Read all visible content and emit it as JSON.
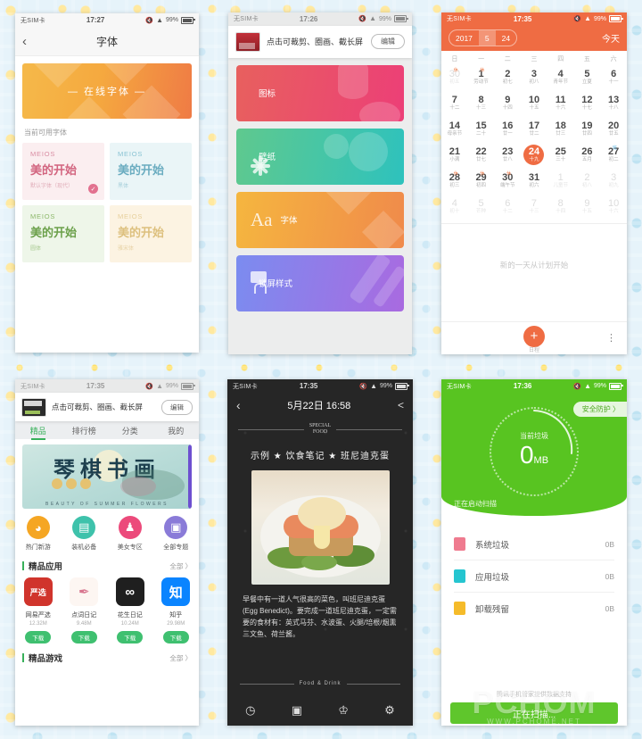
{
  "background": {
    "style": "stars-and-suns-pattern",
    "color": "#e6f3fa"
  },
  "panel_font": {
    "status": {
      "carrier": "无SIM卡",
      "time": "17:27",
      "battery": "99%"
    },
    "nav": {
      "back": "‹",
      "title": "字体"
    },
    "banner_label": "— 在线字体 —",
    "section_label": "当前可用字体",
    "fonts": [
      {
        "eng": "MEIOS",
        "cn": "美的开始",
        "sub": "默认字体（现代）",
        "selected": true,
        "bg": "#fbeef0",
        "eng_color": "#d98da3",
        "cn_color": "#d2647f",
        "sub_color": "#dba0ae"
      },
      {
        "eng": "MEIOS",
        "cn": "美的开始",
        "sub": "黑体",
        "selected": false,
        "bg": "#eaf5f7",
        "eng_color": "#89c3d3",
        "cn_color": "#6aacc0",
        "sub_color": "#9cc9d6"
      },
      {
        "eng": "MEIOS",
        "cn": "美的开始",
        "sub": "圆体",
        "selected": false,
        "bg": "#eef6e9",
        "eng_color": "#8cb86a",
        "cn_color": "#6ba04a",
        "sub_color": "#9ec383"
      },
      {
        "eng": "MEIOS",
        "cn": "美的开始",
        "sub": "雅宋体",
        "selected": false,
        "bg": "#fcf3e2",
        "eng_color": "#e6cf9b",
        "cn_color": "#ddc07e",
        "sub_color": "#e4cd9c"
      }
    ]
  },
  "panel_theme": {
    "status": {
      "carrier": "无SIM卡",
      "time": "17:26",
      "battery": "99%"
    },
    "screenshot_bar": {
      "text": "点击可裁剪、圈画、截长屏",
      "button": "编辑"
    },
    "tiles": [
      {
        "label": "图标",
        "icon": "cylinder-icon"
      },
      {
        "label": "壁纸",
        "icon": "flower-icon"
      },
      {
        "label": "字体",
        "icon": "aa-icon"
      },
      {
        "label": "锁屏样式",
        "icon": "lock-icon"
      }
    ]
  },
  "panel_calendar": {
    "status": {
      "carrier": "无SIM卡",
      "time": "17:35",
      "battery": "99%"
    },
    "header": {
      "year": "2017",
      "month": "5",
      "day": "24",
      "today": "今天"
    },
    "weekdays": [
      "日",
      "一",
      "二",
      "三",
      "四",
      "五",
      "六"
    ],
    "empty_hint": "新的一天从计划开始",
    "fab": {
      "icon": "+",
      "label": "日程"
    },
    "more_icon": "⋮",
    "days": [
      {
        "n": "30",
        "l": "初五",
        "out": true,
        "sup": "休"
      },
      {
        "n": "1",
        "l": "劳动节",
        "out": false,
        "sup": "休"
      },
      {
        "n": "2",
        "l": "初七",
        "out": false
      },
      {
        "n": "3",
        "l": "初八",
        "out": false
      },
      {
        "n": "4",
        "l": "青年节",
        "out": false
      },
      {
        "n": "5",
        "l": "立夏",
        "out": false
      },
      {
        "n": "6",
        "l": "十一",
        "out": false
      },
      {
        "n": "7",
        "l": "十二",
        "out": false
      },
      {
        "n": "8",
        "l": "十三",
        "out": false
      },
      {
        "n": "9",
        "l": "十四",
        "out": false
      },
      {
        "n": "10",
        "l": "十五",
        "out": false
      },
      {
        "n": "11",
        "l": "十六",
        "out": false
      },
      {
        "n": "12",
        "l": "十七",
        "out": false
      },
      {
        "n": "13",
        "l": "十八",
        "out": false
      },
      {
        "n": "14",
        "l": "母亲节",
        "out": false
      },
      {
        "n": "15",
        "l": "二十",
        "out": false
      },
      {
        "n": "16",
        "l": "廿一",
        "out": false
      },
      {
        "n": "17",
        "l": "廿二",
        "out": false
      },
      {
        "n": "18",
        "l": "廿三",
        "out": false
      },
      {
        "n": "19",
        "l": "廿四",
        "out": false
      },
      {
        "n": "20",
        "l": "廿五",
        "out": false
      },
      {
        "n": "21",
        "l": "小满",
        "out": false
      },
      {
        "n": "22",
        "l": "廿七",
        "out": false
      },
      {
        "n": "23",
        "l": "廿八",
        "out": false
      },
      {
        "n": "24",
        "l": "十九",
        "out": false,
        "selected": true
      },
      {
        "n": "25",
        "l": "三十",
        "out": false
      },
      {
        "n": "26",
        "l": "五月",
        "out": false
      },
      {
        "n": "27",
        "l": "初二",
        "out": false,
        "sup": "班",
        "sup_blue": true
      },
      {
        "n": "28",
        "l": "初三",
        "out": false,
        "sup": "休"
      },
      {
        "n": "29",
        "l": "初四",
        "out": false,
        "sup": "休"
      },
      {
        "n": "30",
        "l": "端午节",
        "out": false,
        "sup": "休"
      },
      {
        "n": "31",
        "l": "初六",
        "out": false
      },
      {
        "n": "1",
        "l": "儿童节",
        "out": true
      },
      {
        "n": "2",
        "l": "初八",
        "out": true
      },
      {
        "n": "3",
        "l": "初九",
        "out": true
      },
      {
        "n": "4",
        "l": "初十",
        "out": true
      },
      {
        "n": "5",
        "l": "芒种",
        "out": true
      },
      {
        "n": "6",
        "l": "十二",
        "out": true
      },
      {
        "n": "7",
        "l": "十三",
        "out": true
      },
      {
        "n": "8",
        "l": "十四",
        "out": true
      },
      {
        "n": "9",
        "l": "十五",
        "out": true
      },
      {
        "n": "10",
        "l": "十六",
        "out": true
      }
    ]
  },
  "panel_store": {
    "status": {
      "carrier": "无SIM卡",
      "time": "17:35",
      "battery": "99%"
    },
    "screenshot_bar": {
      "text": "点击可裁剪、圈画、截长屏",
      "button": "编辑"
    },
    "tabs": [
      {
        "label": "精品",
        "active": true
      },
      {
        "label": "排行榜",
        "active": false
      },
      {
        "label": "分类",
        "active": false
      },
      {
        "label": "我的",
        "active": false
      }
    ],
    "banner": {
      "title": "琴棋书画",
      "coins": [
        "诗",
        "酒",
        "花"
      ],
      "eng": "BEAUTY OF SUMMER FLOWERS"
    },
    "categories": [
      {
        "label": "热门新游",
        "color": "#f5a623",
        "icon": "game-icon"
      },
      {
        "label": "装机必备",
        "color": "#3ec2ab",
        "icon": "box-icon"
      },
      {
        "label": "美女专区",
        "color": "#ec4a7b",
        "icon": "person-icon"
      },
      {
        "label": "全部专题",
        "color": "#8a7bd8",
        "icon": "grid-icon"
      }
    ],
    "section_apps": {
      "title": "精品应用",
      "more": "全部 〉"
    },
    "apps": [
      {
        "name": "网易严选",
        "size": "12.32M",
        "download": "下载",
        "color": "#d0342c",
        "glyph": "严选"
      },
      {
        "name": "点词日记",
        "size": "9.48M",
        "download": "下载",
        "color": "#fdf6f2",
        "glyph": "✒"
      },
      {
        "name": "花生日记",
        "size": "10.24M",
        "download": "下载",
        "color": "#1f1f1f",
        "glyph": "∞"
      },
      {
        "name": "知乎",
        "size": "29.98M",
        "download": "下载",
        "color": "#0a84ff",
        "glyph": "知"
      }
    ],
    "section_games": {
      "title": "精品游戏",
      "more": "全部 〉"
    },
    "games": [
      {
        "color": "#8b2f22"
      },
      {
        "color": "#18418f"
      },
      {
        "color": "#2c6e63"
      },
      {
        "color": "#63b832"
      }
    ]
  },
  "panel_note": {
    "status": {
      "carrier": "无SIM卡",
      "time": "17:35",
      "battery": "99%"
    },
    "nav": {
      "back": "‹",
      "title": "5月22日 16:58",
      "share": "share-icon"
    },
    "stamp": {
      "top": "SPECIAL",
      "bottom": "FOOD"
    },
    "title": "示例 ★ 饮食笔记 ★ 班尼迪克蛋",
    "body": "早餐中有一道人气很高的菜色，叫班尼迪克蛋(Egg Benedict)。要完成一道班尼迪克蛋，一定需要的食材有：英式马芬、水波蛋、火腿/培根/烟熏三文鱼、荷兰酱。",
    "footer_text": "Food & Drink",
    "toolbar": [
      {
        "icon": "clock-icon"
      },
      {
        "icon": "image-icon"
      },
      {
        "icon": "shirt-icon"
      },
      {
        "icon": "trash-icon"
      }
    ]
  },
  "panel_cleaner": {
    "status": {
      "carrier": "无SIM卡",
      "time": "17:36",
      "battery": "99%"
    },
    "shield_button": "安全防护 〉",
    "gauge": {
      "caption": "当前垃圾",
      "value": "0",
      "unit": "MB"
    },
    "scanning": "正在启动扫描",
    "rows": [
      {
        "label": "系统垃圾",
        "value": "0B",
        "color": "#ef7b8f",
        "icon": "trash-icon"
      },
      {
        "label": "应用垃圾",
        "value": "0B",
        "color": "#25c5d0",
        "icon": "grid-icon"
      },
      {
        "label": "卸载残留",
        "value": "0B",
        "color": "#f5bb2a",
        "icon": "file-icon"
      }
    ],
    "footer": "腾讯手机管家提供数据支持",
    "cta": "正在扫描...",
    "watermark": {
      "text": "PCHOM",
      "sub": "WWW.PCHOME.NET"
    }
  }
}
